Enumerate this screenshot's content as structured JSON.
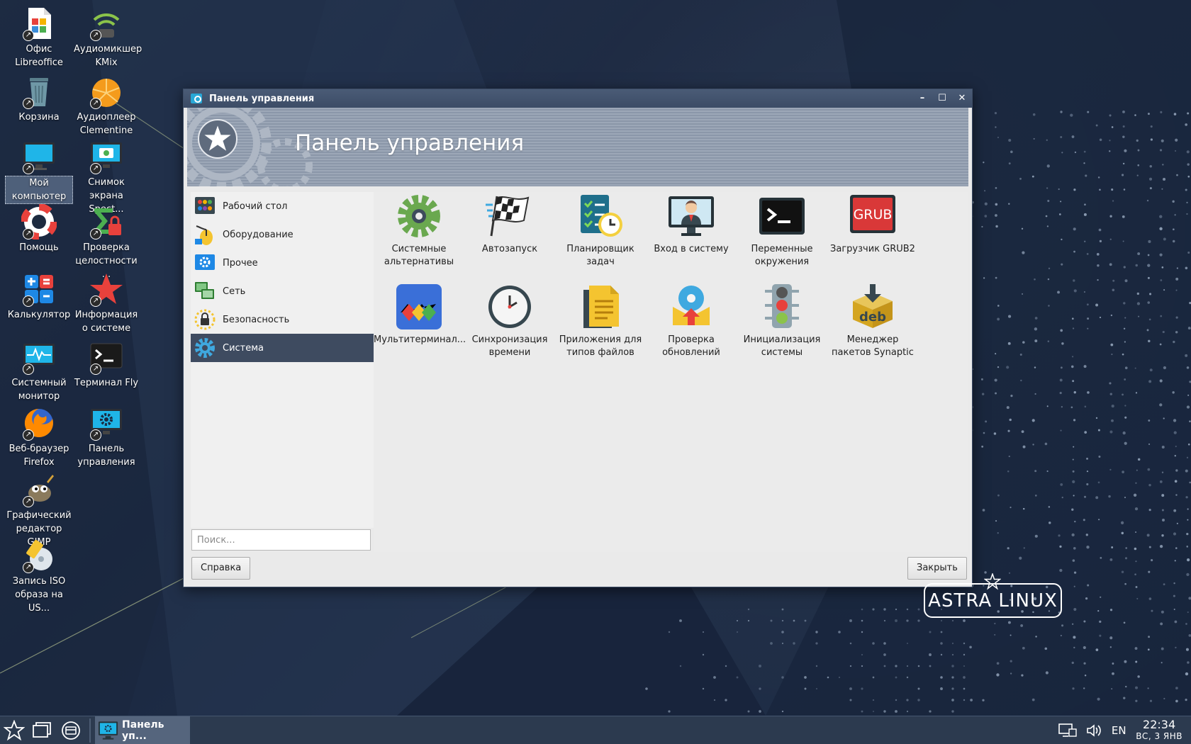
{
  "desktop": {
    "icons": [
      {
        "label": "Офис Libreoffice"
      },
      {
        "label": "Аудиомикшер KMix"
      },
      {
        "label": "Корзина"
      },
      {
        "label": "Аудиоплеер Clementine"
      },
      {
        "label": "Мой компьютер"
      },
      {
        "label": "Снимок экрана Spect..."
      },
      {
        "label": "Помощь"
      },
      {
        "label": "Проверка целостности ..."
      },
      {
        "label": "Калькулятор"
      },
      {
        "label": "Информация о системе"
      },
      {
        "label": "Системный монитор"
      },
      {
        "label": "Терминал Fly"
      },
      {
        "label": "Веб-браузер Firefox"
      },
      {
        "label": "Панель управления"
      },
      {
        "label": "Графический редактор GIMP"
      },
      {
        "label": "Запись ISO образа на US..."
      }
    ],
    "brand": "ASTRA LINUX"
  },
  "window": {
    "title": "Панель управления",
    "header_title": "Панель управления",
    "minimize": "–",
    "maximize": "☐",
    "close": "✕"
  },
  "sidebar": {
    "items": [
      {
        "label": "Рабочий стол"
      },
      {
        "label": "Оборудование"
      },
      {
        "label": "Прочее"
      },
      {
        "label": "Сеть"
      },
      {
        "label": "Безопасность"
      },
      {
        "label": "Система",
        "active": true
      }
    ],
    "search_placeholder": "Поиск..."
  },
  "apps": [
    {
      "label": "Системные альтернативы",
      "icon": "gear-green-icon"
    },
    {
      "label": "Автозапуск",
      "icon": "checkered-flag-icon"
    },
    {
      "label": "Планировщик задач",
      "icon": "scheduler-clipboard-icon"
    },
    {
      "label": "Вход в систему",
      "icon": "login-user-monitor-icon"
    },
    {
      "label": "Переменные окружения",
      "icon": "terminal-prompt-icon"
    },
    {
      "label": "Загрузчик GRUB2",
      "icon": "grub-icon"
    },
    {
      "label": "Мультитерминал...",
      "icon": "multiterminal-icon"
    },
    {
      "label": "Синхронизация времени",
      "icon": "clock-icon"
    },
    {
      "label": "Приложения для типов файлов",
      "icon": "document-icon"
    },
    {
      "label": "Проверка обновлений",
      "icon": "update-check-icon"
    },
    {
      "label": "Инициализация системы",
      "icon": "traffic-light-icon"
    },
    {
      "label": "Менеджер пакетов Synaptic",
      "icon": "deb-package-icon"
    }
  ],
  "buttons": {
    "help": "Справка",
    "close": "Закрыть"
  },
  "taskbar": {
    "task_label": "Панель уп...",
    "lang": "EN",
    "time": "22:34",
    "date": "ВС, 3 ЯНВ"
  },
  "colors": {
    "active_item_bg": "#3e4b60",
    "title_bar": "#3c4c66",
    "taskbar": "#2c3a4f"
  }
}
